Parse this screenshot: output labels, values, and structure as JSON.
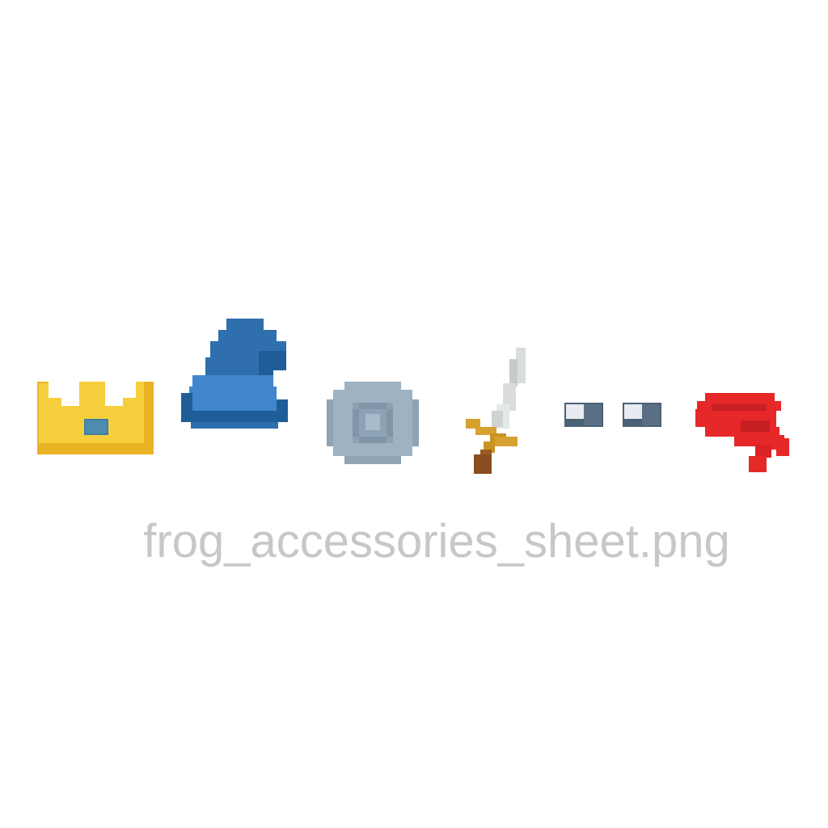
{
  "sheet": {
    "filename": "frog_accessories_sheet.png",
    "background": "#ffffff",
    "label_color": "#c7c7c7"
  },
  "accessories": [
    {
      "name": "crown",
      "icon": "crown-icon",
      "colors": {
        "gold": "#f5cf3d",
        "shade": "#e9b424",
        "gem": "#3f7ea2"
      }
    },
    {
      "name": "wizard hat",
      "icon": "wizard-hat-icon",
      "colors": {
        "main": "#2f6fad",
        "light": "#3f86cd",
        "dark": "#1f5d97"
      }
    },
    {
      "name": "round shield",
      "icon": "shield-icon",
      "colors": {
        "main": "#9fb2c1",
        "dark": "#7f95a8",
        "boss": "#6f879c"
      }
    },
    {
      "name": "sword",
      "icon": "sword-icon",
      "colors": {
        "blade": "#d9dddb",
        "guard": "#d7a12f",
        "grip": "#8a4d1f"
      }
    },
    {
      "name": "glasses",
      "icon": "glasses-icon",
      "colors": {
        "lens": "#e6ecf1",
        "frame": "#4b6175"
      }
    },
    {
      "name": "scarf",
      "icon": "scarf-icon",
      "colors": {
        "main": "#e72828",
        "dark": "#c61f24"
      }
    }
  ]
}
